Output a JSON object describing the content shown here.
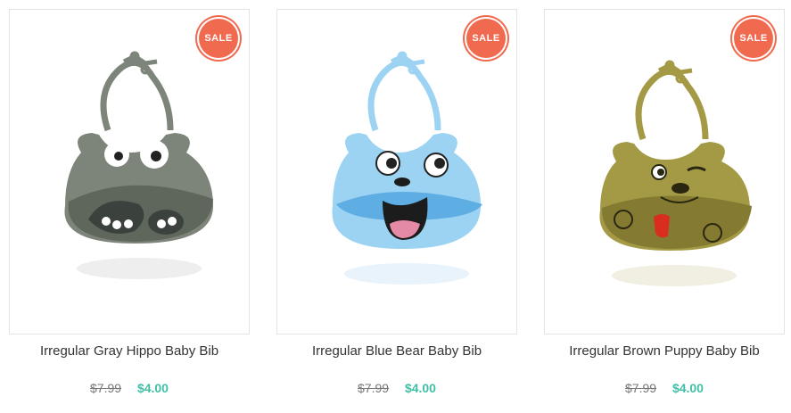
{
  "products": [
    {
      "title": "Irregular Gray Hippo Baby Bib",
      "badge": "SALE",
      "old_price": "$7.99",
      "price": "$4.00",
      "image_icon": "gray-hippo-bib",
      "colors": {
        "main": "#7d857a",
        "dark": "#5f665c",
        "face": "#3b413d"
      }
    },
    {
      "title": "Irregular Blue Bear Baby Bib",
      "badge": "SALE",
      "old_price": "$7.99",
      "price": "$4.00",
      "image_icon": "blue-bear-bib",
      "colors": {
        "main": "#9dd3f2",
        "dark": "#5eaee3",
        "face": "#1c1c1c"
      }
    },
    {
      "title": "Irregular Brown Puppy Baby Bib",
      "badge": "SALE",
      "old_price": "$7.99",
      "price": "$4.00",
      "image_icon": "brown-puppy-bib",
      "colors": {
        "main": "#a49a45",
        "dark": "#847a32",
        "face": "#2a2710"
      }
    }
  ],
  "colors": {
    "sale_badge": "#f06a50",
    "price_accent": "#3fbfa5",
    "old_price": "#777777",
    "card_border": "#e3e3e3"
  }
}
